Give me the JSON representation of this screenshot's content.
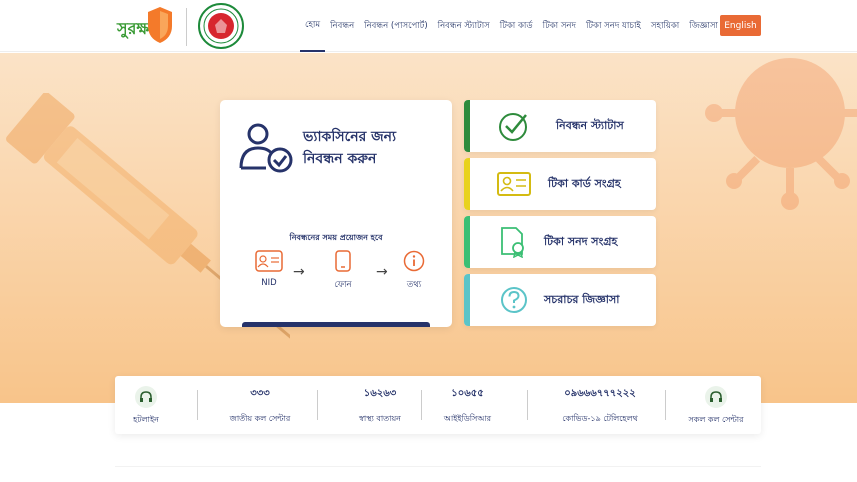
{
  "header": {
    "logo_text": "সুরক্ষা",
    "nav": [
      "হোম",
      "নিবন্ধন",
      "নিবন্ধন (পাসপোর্ট)",
      "নিবন্ধন স্ট্যাটাস",
      "টিকা কার্ড",
      "টিকা সনদ",
      "টিকা সনদ যাচাই",
      "সহায়িকা",
      "জিজ্ঞাসা"
    ],
    "lang_button": "English"
  },
  "registration": {
    "title": "ভ্যাকসিনের জন্য নিবন্ধন করুন",
    "subtitle": "নিবন্ধনের সময় প্রয়োজন হবে",
    "steps": [
      "NID",
      "ফোন",
      "তথ্য"
    ]
  },
  "side_cards": [
    {
      "label": "নিবন্ধন স্ট্যাটাস",
      "accent": "#2e8b3c"
    },
    {
      "label": "টিকা কার্ড সংগ্রহ",
      "accent": "#e8d21d"
    },
    {
      "label": "টিকা সনদ সংগ্রহ",
      "accent": "#3bbf74"
    },
    {
      "label": "সচরাচর জিজ্ঞাসা",
      "accent": "#5bc4c8"
    }
  ],
  "hotlines": {
    "first_label": "হটলাইন",
    "items": [
      {
        "number": "৩৩৩",
        "label": "জাতীয় কল সেন্টার"
      },
      {
        "number": "১৬২৬৩",
        "label": "স্বাস্থ্য বাতায়ন"
      },
      {
        "number": "১০৬৫৫",
        "label": "আইইডিসিআর"
      },
      {
        "number": "০৯৬৬৬৭৭৭২২২",
        "label": "কোভিড-১৯ টেলিহেলথ"
      }
    ],
    "last_label": "সকল কল সেন্টার"
  },
  "colors": {
    "primary": "#26336a",
    "accent": "#e96a35",
    "brand_green": "#3a9b35"
  }
}
